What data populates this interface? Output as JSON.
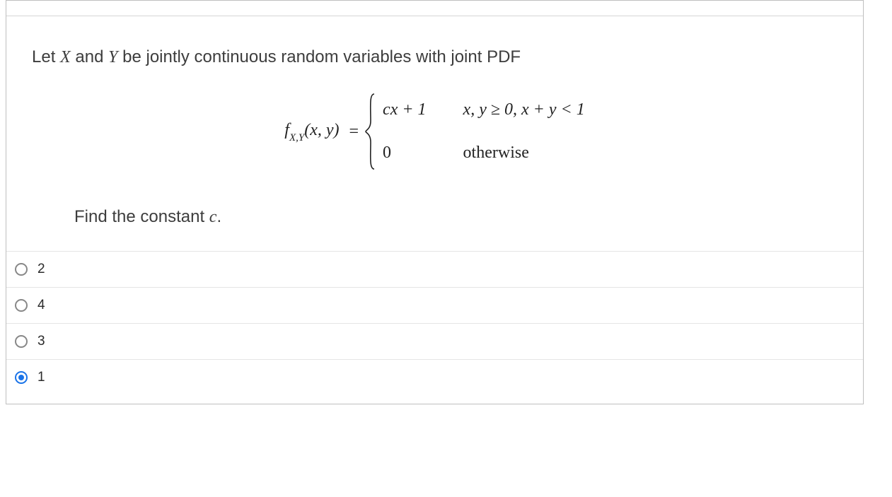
{
  "question": {
    "intro_pre": "Let ",
    "var_x": "X",
    "intro_mid": " and ",
    "var_y": "Y",
    "intro_post": " be jointly continuous random variables with joint PDF",
    "lhs_f": "f",
    "lhs_sub": "X,Y",
    "lhs_args": "(x, y)",
    "eq": " = ",
    "case1_expr": "cx + 1",
    "case1_cond": "x, y ≥ 0, x + y < 1",
    "case2_expr": "0",
    "case2_cond": "otherwise",
    "prompt_pre": "Find the constant ",
    "prompt_var": "c",
    "prompt_post": "."
  },
  "options": [
    {
      "label": "2",
      "selected": false
    },
    {
      "label": "4",
      "selected": false
    },
    {
      "label": "3",
      "selected": false
    },
    {
      "label": "1",
      "selected": true
    }
  ]
}
